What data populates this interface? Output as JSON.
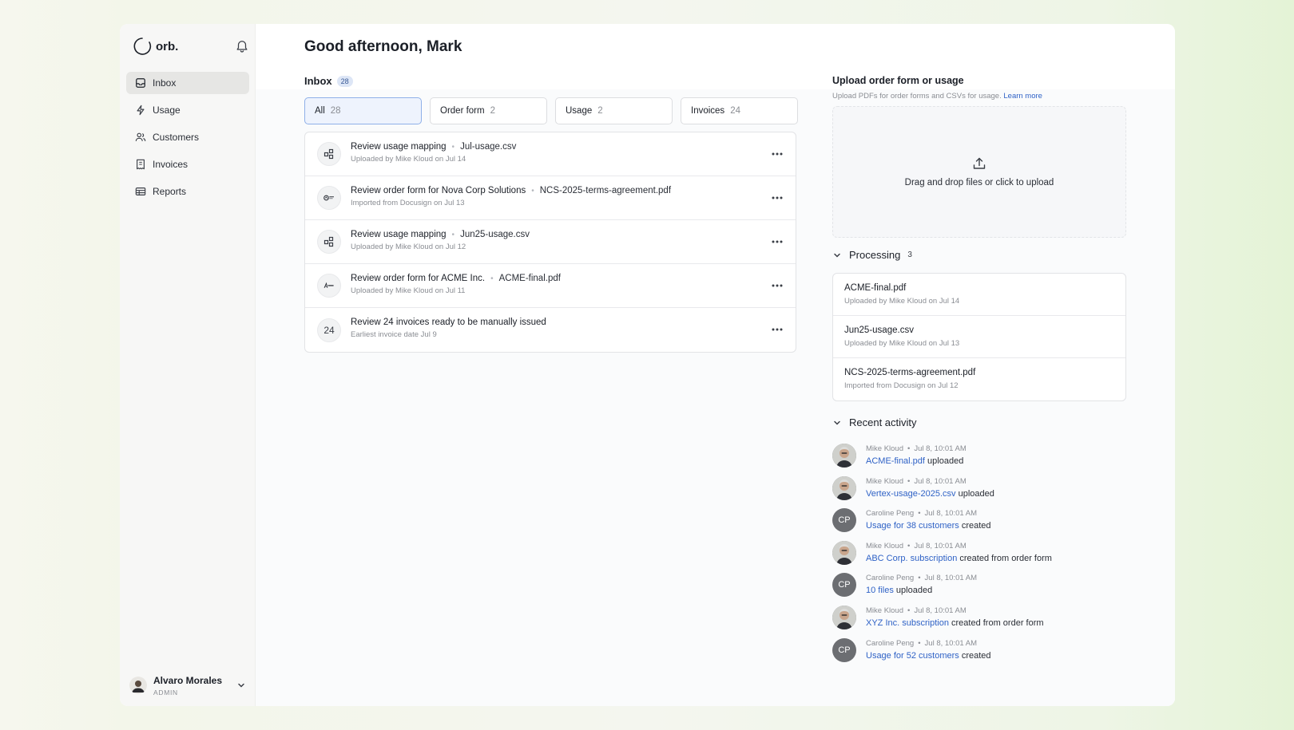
{
  "app": {
    "logo_text": "orb."
  },
  "sidebar": {
    "items": [
      {
        "label": "Inbox",
        "icon": "inbox-icon",
        "active": true
      },
      {
        "label": "Usage",
        "icon": "lightning-icon",
        "active": false
      },
      {
        "label": "Customers",
        "icon": "users-icon",
        "active": false
      },
      {
        "label": "Invoices",
        "icon": "receipt-icon",
        "active": false
      },
      {
        "label": "Reports",
        "icon": "table-icon",
        "active": false
      }
    ],
    "user": {
      "name": "Alvaro Morales",
      "role": "ADMIN"
    }
  },
  "main": {
    "greeting": "Good afternoon, Mark",
    "inbox": {
      "title": "Inbox",
      "count": "28",
      "tabs": [
        {
          "label": "All",
          "count": "28",
          "active": true
        },
        {
          "label": "Order form",
          "count": "2",
          "active": false
        },
        {
          "label": "Usage",
          "count": "2",
          "active": false
        },
        {
          "label": "Invoices",
          "count": "24",
          "active": false
        }
      ],
      "tasks": [
        {
          "title": "Review usage mapping",
          "file": "Jul-usage.csv",
          "sub": "Uploaded by Mike Kloud on Jul 14",
          "icon": "mapping-icon"
        },
        {
          "title": "Review order form for Nova Corp Solutions",
          "file": "NCS-2025-terms-agreement.pdf",
          "sub": "Imported from Docusign on Jul 13",
          "icon": "nova-logo-icon"
        },
        {
          "title": "Review usage mapping",
          "file": "Jun25-usage.csv",
          "sub": "Uploaded by Mike Kloud on Jul 12",
          "icon": "mapping-icon"
        },
        {
          "title": "Review order form for ACME Inc.",
          "file": "ACME-final.pdf",
          "sub": "Uploaded by Mike Kloud on Jul 11",
          "icon": "acme-logo-icon"
        },
        {
          "title": "Review 24 invoices ready to be manually issued",
          "file": "",
          "sub": "Earliest invoice date Jul 9",
          "icon_text": "24"
        }
      ]
    },
    "upload": {
      "title": "Upload order form or usage",
      "subtitle": "Upload PDFs for order forms and CSVs for usage.",
      "learn_more": "Learn more",
      "dropzone_text": "Drag and drop files or click to upload"
    },
    "processing": {
      "title": "Processing",
      "count": "3",
      "items": [
        {
          "name": "ACME-final.pdf",
          "sub": "Uploaded by Mike Kloud on Jul 14"
        },
        {
          "name": "Jun25-usage.csv",
          "sub": "Uploaded by Mike Kloud on Jul 13"
        },
        {
          "name": "NCS-2025-terms-agreement.pdf",
          "sub": "Imported from Docusign on Jul 12"
        }
      ]
    },
    "activity": {
      "title": "Recent activity",
      "items": [
        {
          "user": "Mike Kloud",
          "time": "Jul 8, 10:01 AM",
          "link": "ACME-final.pdf",
          "action": "uploaded",
          "avatar": "photo"
        },
        {
          "user": "Mike Kloud",
          "time": "Jul 8, 10:01 AM",
          "link": "Vertex-usage-2025.csv",
          "action": "uploaded",
          "avatar": "photo"
        },
        {
          "user": "Caroline Peng",
          "time": "Jul 8, 10:01 AM",
          "link": "Usage for 38 customers",
          "action": "created",
          "avatar": "CP"
        },
        {
          "user": "Mike Kloud",
          "time": "Jul 8, 10:01 AM",
          "link": "ABC Corp. subscription",
          "action": "created from order form",
          "avatar": "photo"
        },
        {
          "user": "Caroline Peng",
          "time": "Jul 8, 10:01 AM",
          "link": "10 files",
          "action": "uploaded",
          "avatar": "CP"
        },
        {
          "user": "Mike Kloud",
          "time": "Jul 8, 10:01 AM",
          "link": "XYZ Inc. subscription",
          "action": "created from order form",
          "avatar": "photo"
        },
        {
          "user": "Caroline Peng",
          "time": "Jul 8, 10:01 AM",
          "link": "Usage for 52 customers",
          "action": "created",
          "avatar": "CP"
        }
      ]
    }
  },
  "colors": {
    "accent": "#2f62c6",
    "active_tab_bg": "#eef3fd",
    "badge_bg": "#dde6f6"
  }
}
